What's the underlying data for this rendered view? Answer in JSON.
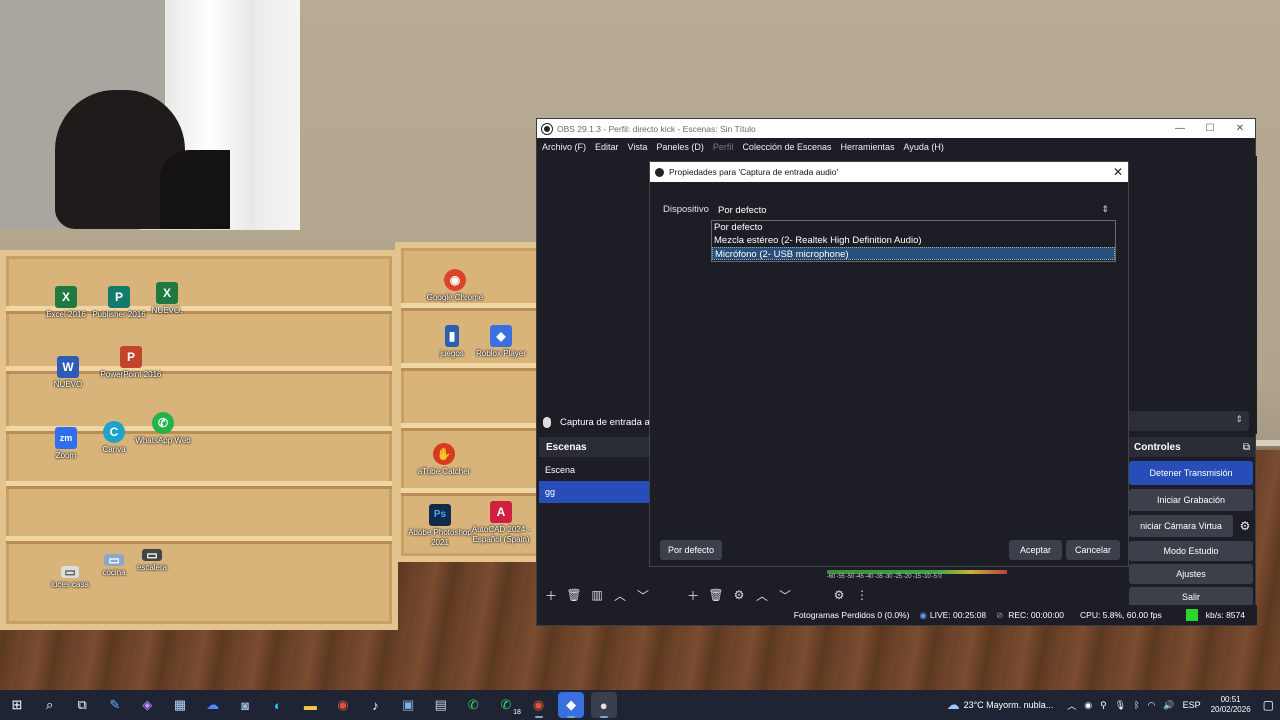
{
  "desktop": {
    "icons_left": [
      {
        "label": "Excel 2016",
        "glyph": "X",
        "color": "#1f7a40"
      },
      {
        "label": "Publisher 2016",
        "glyph": "P",
        "color": "#157a6e"
      },
      {
        "label": "NUEVO.",
        "glyph": "X",
        "color": "#1f7a40"
      },
      {
        "label": "NUEVO",
        "glyph": "W",
        "color": "#2b5cb8"
      },
      {
        "label": "PowerPoint 2016",
        "glyph": "P",
        "color": "#c4432b"
      },
      {
        "label": "Zoom",
        "glyph": "zm",
        "color": "#2d6ff0"
      },
      {
        "label": "Canva",
        "glyph": "C",
        "color": "#1fa4c9"
      },
      {
        "label": "WhatsApp Web",
        "glyph": "✆",
        "color": "#24b24b"
      },
      {
        "label": "luces casa",
        "glyph": "▭",
        "color": "#dddddd"
      },
      {
        "label": "cocina",
        "glyph": "▭",
        "color": "#8aa8c8"
      },
      {
        "label": "escalera",
        "glyph": "▭",
        "color": "#444444"
      }
    ],
    "icons_right": [
      {
        "label": "Google Chrome",
        "glyph": "◉",
        "color": "#d9442b"
      },
      {
        "label": "juegos",
        "glyph": "▮",
        "color": "#2a5fb0"
      },
      {
        "label": "Roblox Player",
        "glyph": "◆",
        "color": "#3a6fe0"
      },
      {
        "label": "aTube Catcher",
        "glyph": "✋",
        "color": "#d63a1f"
      },
      {
        "label": "Adobe Photoshop 2021",
        "glyph": "Ps",
        "color": "#0f2a4a"
      },
      {
        "label": "AutoCAD 2024 - Español (Spain)",
        "glyph": "A",
        "color": "#d02040"
      }
    ]
  },
  "obs": {
    "title": "OBS 29.1.3 - Perfil: directo kick - Escenas: Sin Título",
    "window_controls": {
      "minimize": "—",
      "maximize": "☐",
      "close": "✕"
    },
    "menu": [
      "Archivo (F)",
      "Editar",
      "Vista",
      "Paneles (D)",
      "Perfil",
      "Colección de Escenas",
      "Herramientas",
      "Ayuda (H)"
    ],
    "menu_disabled": "Perfil",
    "source_label": "Captura de entrada au",
    "scenes": {
      "title": "Escenas",
      "items": [
        "Escena",
        "gg"
      ],
      "selected": "gg"
    },
    "controls": {
      "title": "Controles",
      "buttons": [
        "Detener Transmisión",
        "Iniciar Grabación",
        "niciar Cámara Virtua",
        "Modo Estudio",
        "Ajustes",
        "Salir"
      ]
    },
    "meter_scale": "-60 -55 -50 -45 -40 -35 -30 -25 -20 -15 -10 -5 0",
    "status": {
      "frames": "Fotogramas Perdidos 0 (0.0%)",
      "live": "LIVE: 00:25:08",
      "rec": "REC: 00:00:00",
      "cpu": "CPU: 5.8%, 60.00 fps",
      "kbs": "kb/s: 8574"
    },
    "accent": "#284cb8"
  },
  "dialog": {
    "title": "Propiedades para 'Captura de entrada audio'",
    "device_label": "Dispositivo",
    "device_value": "Por defecto",
    "options": [
      "Por defecto",
      "Mezcla estéreo (2- Realtek High Definition Audio)",
      "Micrófono (2- USB microphone)"
    ],
    "highlighted_option": "Micrófono (2- USB microphone)",
    "defaults_button": "Por defecto",
    "accept_button": "Aceptar",
    "cancel_button": "Cancelar"
  },
  "taskbar": {
    "weather": "23°C  Mayorm. nubla...",
    "language": "ESP",
    "time": "00:51",
    "date": "20/02/2026",
    "whatsapp_badge": "18"
  }
}
